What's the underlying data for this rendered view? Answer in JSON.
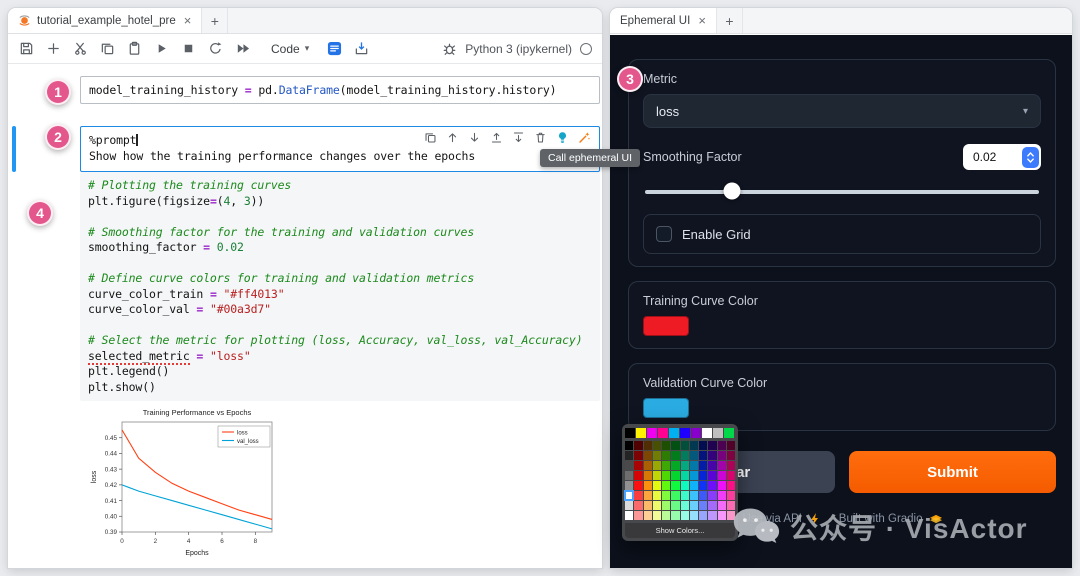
{
  "left_window": {
    "tab_title": "tutorial_example_hotel_pre",
    "tab_close": "×",
    "new_tab": "+",
    "toolbar": {
      "mode_label": "Code",
      "kernel_label": "Python 3 (ipykernel)"
    },
    "cell1": {
      "lines": [
        [
          [
            "p",
            "model_training_history "
          ],
          [
            "o",
            "="
          ],
          [
            "p",
            " pd."
          ],
          [
            "f",
            "DataFrame"
          ],
          [
            "p",
            "(model_training_history.history)"
          ]
        ]
      ]
    },
    "cell2": {
      "tooltip": "Call ephemeral UI",
      "lines": [
        [
          [
            "m",
            "%prompt"
          ],
          [
            "cursor",
            ""
          ]
        ],
        [
          [
            "p",
            "Show how the training performance changes over the epochs"
          ]
        ]
      ]
    },
    "cell4": {
      "lines": [
        [
          [
            "c",
            "# Plotting the training curves"
          ]
        ],
        [
          [
            "p",
            "plt.figure(figsize"
          ],
          [
            "o",
            "="
          ],
          [
            "p",
            "("
          ],
          [
            "n",
            "4"
          ],
          [
            "p",
            ", "
          ],
          [
            "n",
            "3"
          ],
          [
            "p",
            "))"
          ]
        ],
        [],
        [
          [
            "c",
            "# Smoothing factor for the training and validation curves"
          ]
        ],
        [
          [
            "p",
            "smoothing_factor "
          ],
          [
            "o",
            "="
          ],
          [
            "p",
            " "
          ],
          [
            "n",
            "0.02"
          ]
        ],
        [],
        [
          [
            "c",
            "# Define curve colors for training and validation metrics"
          ]
        ],
        [
          [
            "p",
            "curve_color_train "
          ],
          [
            "o",
            "="
          ],
          [
            "p",
            " "
          ],
          [
            "s",
            "\"#ff4013\""
          ]
        ],
        [
          [
            "p",
            "curve_color_val "
          ],
          [
            "o",
            "="
          ],
          [
            "p",
            " "
          ],
          [
            "s",
            "\"#00a3d7\""
          ]
        ],
        [],
        [
          [
            "c",
            "# Select the metric for plotting (loss, Accuracy, val_loss, val_Accuracy)"
          ]
        ],
        [
          [
            "sq",
            "selected_metric"
          ],
          [
            "p",
            " "
          ],
          [
            "o",
            "="
          ],
          [
            "p",
            " "
          ],
          [
            "s",
            "\"loss\""
          ]
        ],
        [
          [
            "p",
            "plt.legend()"
          ]
        ],
        [
          [
            "p",
            "plt.show()"
          ]
        ]
      ]
    }
  },
  "chart_data": {
    "type": "line",
    "title": "Training Performance vs Epochs",
    "xlabel": "Epochs",
    "ylabel": "loss",
    "x": [
      0,
      1,
      2,
      3,
      4,
      5,
      6,
      7,
      8,
      9
    ],
    "series": [
      {
        "name": "loss",
        "color": "#ff4013",
        "values": [
          0.455,
          0.437,
          0.428,
          0.421,
          0.416,
          0.412,
          0.408,
          0.404,
          0.401,
          0.398
        ]
      },
      {
        "name": "val_loss",
        "color": "#00a3d7",
        "values": [
          0.42,
          0.416,
          0.413,
          0.41,
          0.407,
          0.404,
          0.401,
          0.398,
          0.395,
          0.392
        ]
      }
    ],
    "ylim": [
      0.39,
      0.46
    ],
    "yticks": [
      0.39,
      0.4,
      0.41,
      0.42,
      0.43,
      0.44,
      0.45
    ],
    "xticks": [
      0,
      2,
      4,
      6,
      8
    ],
    "legend_position": "upper right",
    "grid": false
  },
  "right_window": {
    "tab_title": "Ephemeral UI",
    "tab_close": "×",
    "new_tab": "+",
    "metric_label": "Metric",
    "metric_value": "loss",
    "smoothing_label": "Smoothing Factor",
    "smoothing_value": "0.02",
    "slider_percent": 22,
    "grid_label": "Enable Grid",
    "grid_checked": false,
    "train_color_label": "Training Curve Color",
    "train_color": "#ee1b24",
    "val_color_label": "Validation Curve Color",
    "val_color": "#2aabe2",
    "clear_label": "Clear",
    "submit_label": "Submit",
    "footer_api": "Use via API",
    "footer_sep": "·",
    "footer_gradio": "Built with Gradio"
  },
  "color_picker": {
    "show_colors_label": "Show Colors...",
    "top_row": [
      "#000000",
      "#fff200",
      "#f000f0",
      "#ff0090",
      "#00b0f0",
      "#1f00ff",
      "#8800cc",
      "#ffffff",
      "#bfbfbf",
      "#00d84a"
    ],
    "grid_cols": 12,
    "grid_rows": 8,
    "selected_color": "#ffffff"
  },
  "badges": [
    "1",
    "2",
    "3",
    "4"
  ],
  "watermark": "公众号 · VisActor"
}
